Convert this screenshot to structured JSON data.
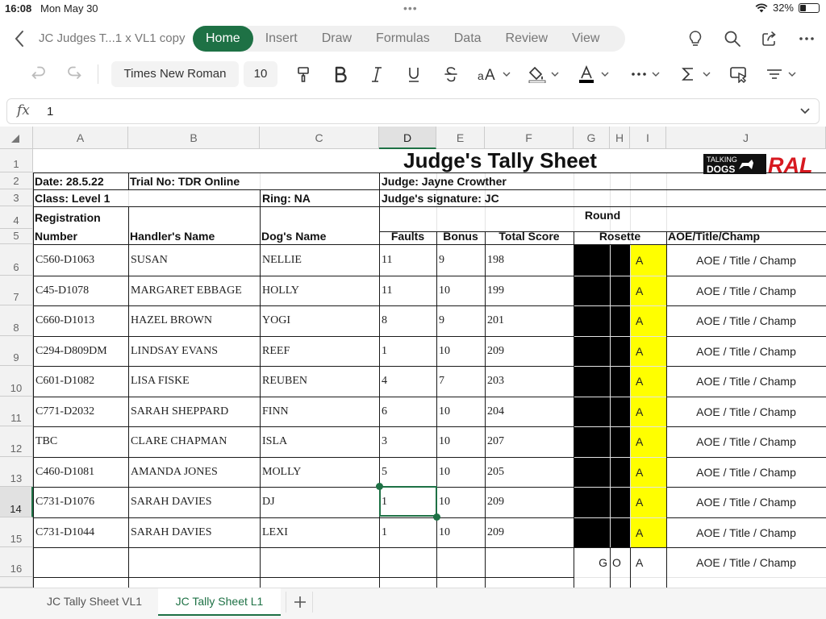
{
  "status": {
    "time": "16:08",
    "date": "Mon May 30",
    "battery": "32%",
    "battery_level": 0.32,
    "dots": "•••"
  },
  "nav": {
    "doc_title": "JC Judges T...1 x VL1 copy",
    "tabs": [
      {
        "label": "Home",
        "active": true
      },
      {
        "label": "Insert"
      },
      {
        "label": "Draw"
      },
      {
        "label": "Formulas"
      },
      {
        "label": "Data"
      },
      {
        "label": "Review"
      },
      {
        "label": "View"
      }
    ],
    "icons": [
      "lightbulb-icon",
      "search-icon",
      "share-icon",
      "more-icon"
    ]
  },
  "ribbon": {
    "font_name": "Times New Roman",
    "font_size": "10",
    "font_color": "#000000"
  },
  "formula_bar": {
    "fx": "fx",
    "value": "1"
  },
  "columns": [
    "A",
    "B",
    "C",
    "D",
    "E",
    "F",
    "G",
    "H",
    "I",
    "J"
  ],
  "rows": [
    "1",
    "2",
    "3",
    "4",
    "5",
    "6",
    "7",
    "8",
    "9",
    "10",
    "11",
    "12",
    "13",
    "14",
    "15",
    "16"
  ],
  "selection": {
    "cell": "D14",
    "column": "D",
    "row": "14"
  },
  "sheet": {
    "title": "Judge's Tally Sheet",
    "logo": {
      "line1": "TALKING",
      "line2": "DOGS",
      "brand": "RAL",
      "brand_color": "#d71920"
    },
    "date": "Date: 28.5.22",
    "trial": "Trial No: TDR Online",
    "judge": "Judge: Jayne Crowther",
    "class": "Class: Level 1",
    "ring": "Ring: NA",
    "signature": "Judge's signature: JC",
    "round": "Round",
    "headers": {
      "registration_line1": "Registration",
      "registration_line2": "Number",
      "handler": "Handler's Name",
      "dog": "Dog's Name",
      "faults": "Faults",
      "bonus": "Bonus",
      "total": "Total Score",
      "rosette": "Rosette",
      "aoe": "AOE/Title/Champ"
    },
    "entries": [
      {
        "reg": "C560-D1063",
        "handler": "SUSAN",
        "dog": "NELLIE",
        "faults": "11",
        "bonus": "9",
        "total": "198",
        "rosette": "A",
        "aoe": "AOE / Title / Champ"
      },
      {
        "reg": "C45-D1078",
        "handler": "MARGARET EBBAGE",
        "dog": "HOLLY",
        "faults": "11",
        "bonus": "10",
        "total": "199",
        "rosette": "A",
        "aoe": "AOE / Title / Champ"
      },
      {
        "reg": "C660-D1013",
        "handler": "HAZEL BROWN",
        "dog": "YOGI",
        "faults": "8",
        "bonus": "9",
        "total": "201",
        "rosette": "A",
        "aoe": "AOE / Title / Champ"
      },
      {
        "reg": "C294-D809DM",
        "handler": "LINDSAY EVANS",
        "dog": "REEF",
        "faults": "1",
        "bonus": "10",
        "total": "209",
        "rosette": "A",
        "aoe": "AOE / Title / Champ"
      },
      {
        "reg": "C601-D1082",
        "handler": "LISA FISKE",
        "dog": "REUBEN",
        "faults": "4",
        "bonus": "7",
        "total": "203",
        "rosette": "A",
        "aoe": "AOE / Title / Champ"
      },
      {
        "reg": "C771-D2032",
        "handler": "SARAH SHEPPARD",
        "dog": "FINN",
        "faults": "6",
        "bonus": "10",
        "total": "204",
        "rosette": "A",
        "aoe": "AOE / Title / Champ"
      },
      {
        "reg": "TBC",
        "handler": "CLARE CHAPMAN",
        "dog": "ISLA",
        "faults": "3",
        "bonus": "10",
        "total": "207",
        "rosette": "A",
        "aoe": "AOE / Title / Champ"
      },
      {
        "reg": "C460-D1081",
        "handler": "AMANDA JONES",
        "dog": "MOLLY",
        "faults": "5",
        "bonus": "10",
        "total": "205",
        "rosette": "A",
        "aoe": "AOE / Title / Champ"
      },
      {
        "reg": "C731-D1076",
        "handler": "SARAH DAVIES",
        "dog": "DJ",
        "faults": "1",
        "bonus": "10",
        "total": "209",
        "rosette": "A",
        "aoe": "AOE / Title / Champ"
      },
      {
        "reg": "C731-D1044",
        "handler": "SARAH DAVIES",
        "dog": "LEXI",
        "faults": "1",
        "bonus": "10",
        "total": "209",
        "rosette": "A",
        "aoe": "AOE / Title / Champ"
      },
      {
        "reg": "",
        "handler": "",
        "dog": "",
        "faults": "",
        "bonus": "",
        "total": "",
        "rosette": "A",
        "rosette_g": "G",
        "rosette_o": "O",
        "aoe": "AOE / Title / Champ"
      }
    ],
    "colors": {
      "rosette_fill": "#000000",
      "rosette_highlight": "#ffff00",
      "accent": "#1e7145"
    }
  },
  "sheet_tabs": [
    {
      "label": "JC Tally Sheet VL1",
      "active": false
    },
    {
      "label": "JC Tally Sheet L1",
      "active": true
    }
  ],
  "add_sheet_label": "+"
}
